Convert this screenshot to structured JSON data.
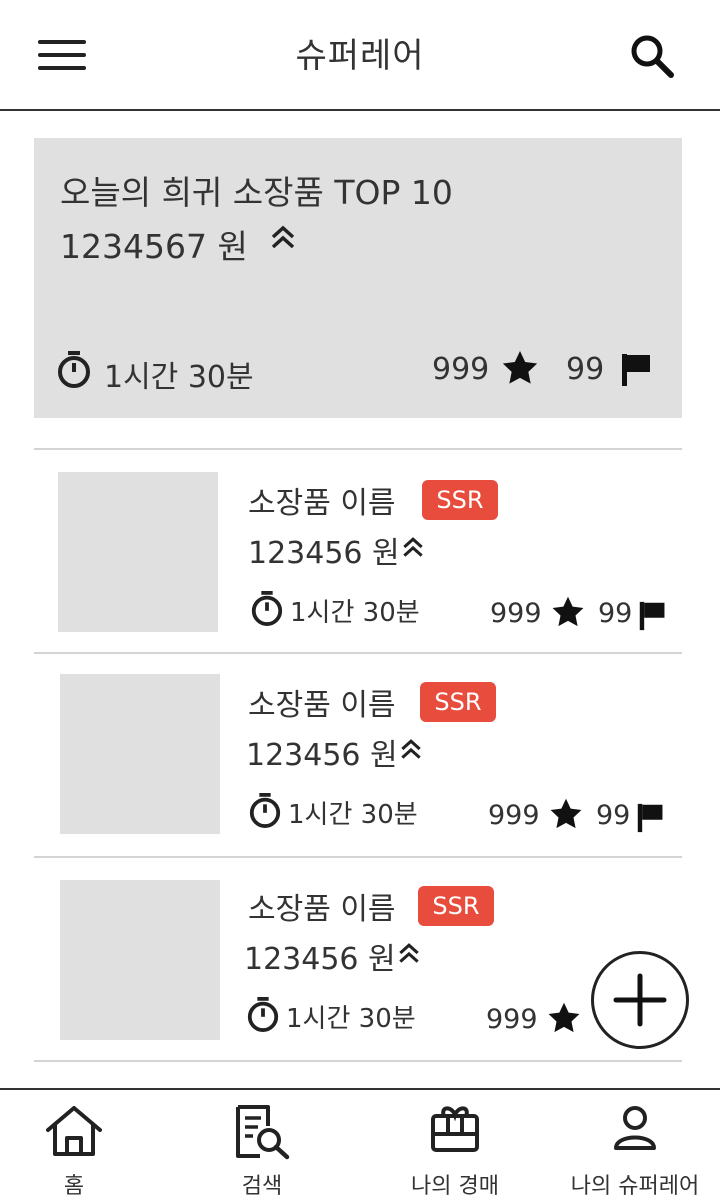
{
  "header": {
    "title": "슈퍼레어",
    "menu_icon": "hamburger-menu-icon",
    "search_icon": "search-icon"
  },
  "featured": {
    "title": "오늘의 희귀 소장품 TOP 10",
    "price": "1234567 원",
    "time_left": "1시간 30분",
    "stars": "999",
    "flags": "99"
  },
  "items": [
    {
      "name": "소장품 이름",
      "badge": "SSR",
      "price": "123456 원",
      "time_left": "1시간 30분",
      "stars": "999",
      "flags": "99"
    },
    {
      "name": "소장품 이름",
      "badge": "SSR",
      "price": "123456 원",
      "time_left": "1시간 30분",
      "stars": "999",
      "flags": "99"
    },
    {
      "name": "소장품 이름",
      "badge": "SSR",
      "price": "123456 원",
      "time_left": "1시간 30분",
      "stars": "999",
      "flags": ""
    }
  ],
  "bottom_nav": [
    {
      "label": "홈",
      "icon": "home-icon"
    },
    {
      "label": "검색",
      "icon": "search-document-icon"
    },
    {
      "label": "나의 경매",
      "icon": "gift-box-icon"
    },
    {
      "label": "나의 슈퍼레어",
      "icon": "user-icon"
    }
  ],
  "colors": {
    "badge": "#e74c3c",
    "card_bg": "#e0e0e0",
    "text": "#333333",
    "divider": "#d4d4d4"
  }
}
